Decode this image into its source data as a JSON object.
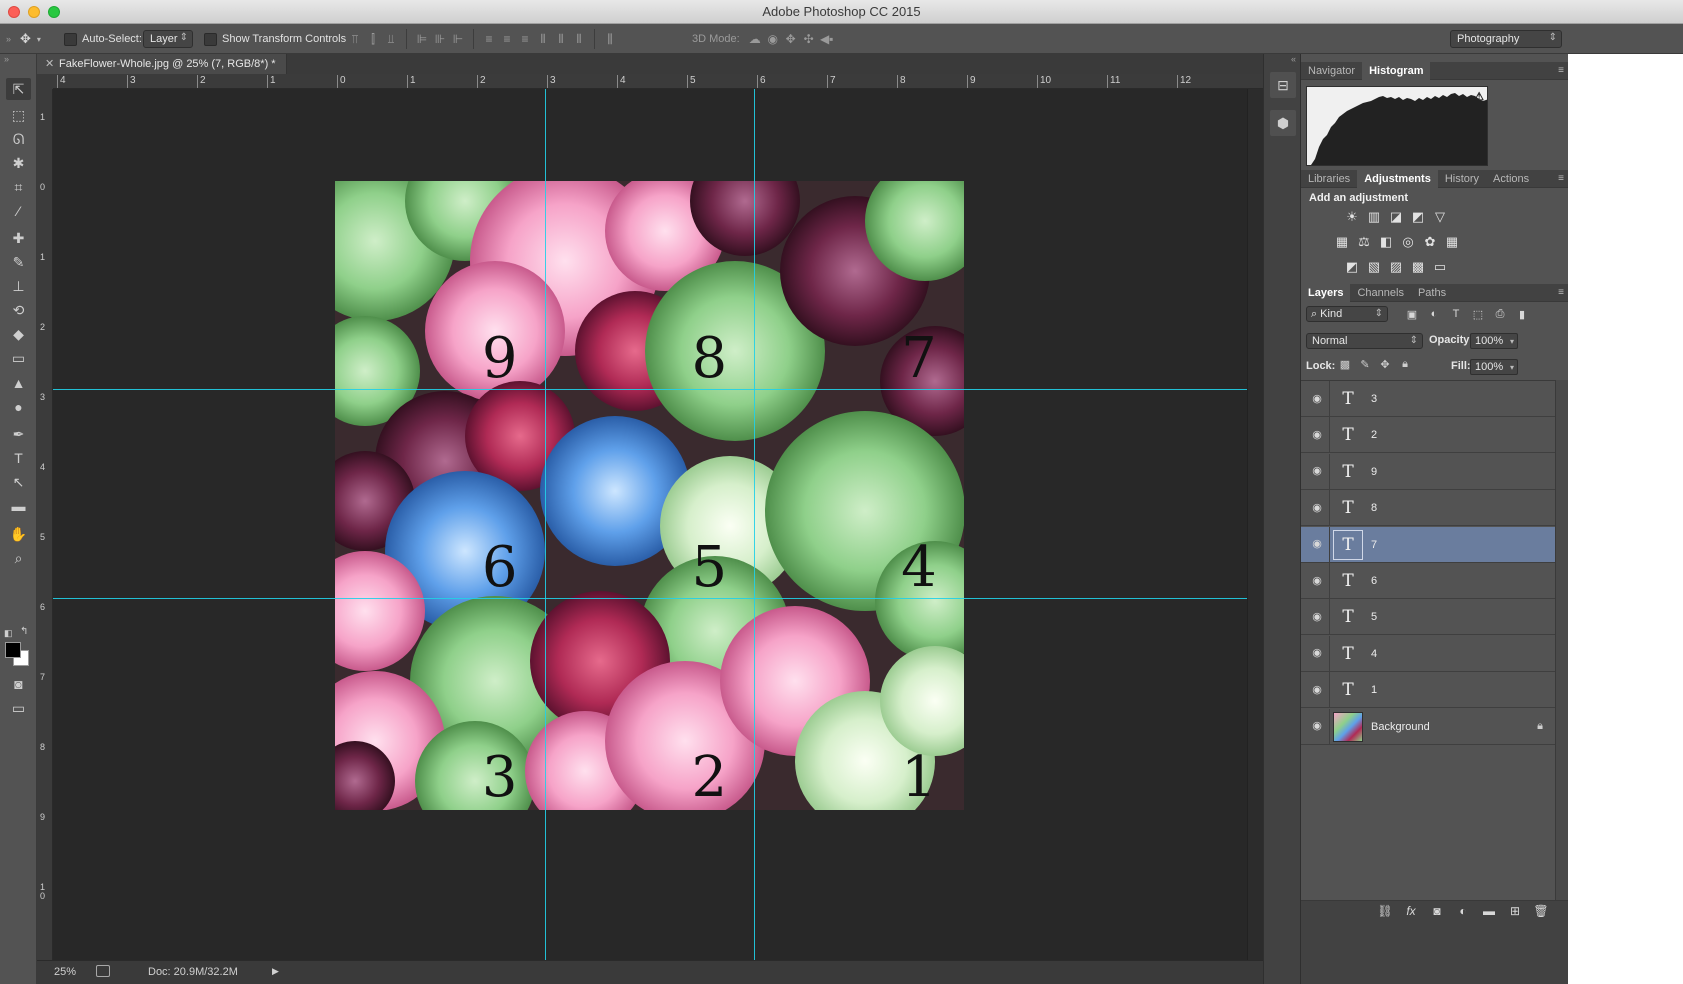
{
  "window": {
    "title": "Adobe Photoshop CC 2015"
  },
  "options_bar": {
    "auto_select_label": "Auto-Select:",
    "auto_select_value": "Layer",
    "show_transform_label": "Show Transform Controls",
    "mode_3d_label": "3D Mode:",
    "workspace": "Photography"
  },
  "document": {
    "tab_title": "FakeFlower-Whole.jpg @ 25% (7, RGB/8*) *",
    "ruler_h": [
      "4",
      "3",
      "2",
      "1",
      "0",
      "1",
      "2",
      "3",
      "4",
      "5",
      "6",
      "7",
      "8",
      "9",
      "10",
      "11",
      "12"
    ],
    "ruler_v": [
      "1",
      "0",
      "1",
      "2",
      "3",
      "4",
      "5",
      "6",
      "7",
      "8",
      "9",
      "1\n0"
    ],
    "cell_numbers": [
      "9",
      "8",
      "7",
      "6",
      "5",
      "4",
      "3",
      "2",
      "1"
    ],
    "status": {
      "zoom": "25%",
      "doc": "Doc: 20.9M/32.2M"
    }
  },
  "panels": {
    "top_tabs": [
      "Navigator",
      "Histogram"
    ],
    "top_active": "Histogram",
    "mid_tabs": [
      "Libraries",
      "Adjustments",
      "History",
      "Actions"
    ],
    "mid_active": "Adjustments",
    "adjust_title": "Add an adjustment",
    "layer_tabs": [
      "Layers",
      "Channels",
      "Paths"
    ],
    "layer_active": "Layers",
    "filter_kind": "Kind",
    "blend_mode": "Normal",
    "opacity_label": "Opacity:",
    "opacity_value": "100%",
    "lock_label": "Lock:",
    "fill_label": "Fill:",
    "fill_value": "100%"
  },
  "layers": [
    {
      "name": "3",
      "type": "text",
      "selected": false
    },
    {
      "name": "2",
      "type": "text",
      "selected": false
    },
    {
      "name": "9",
      "type": "text",
      "selected": false
    },
    {
      "name": "8",
      "type": "text",
      "selected": false
    },
    {
      "name": "7",
      "type": "text",
      "selected": true
    },
    {
      "name": "6",
      "type": "text",
      "selected": false
    },
    {
      "name": "5",
      "type": "text",
      "selected": false
    },
    {
      "name": "4",
      "type": "text",
      "selected": false
    },
    {
      "name": "1",
      "type": "text",
      "selected": false
    },
    {
      "name": "Background",
      "type": "image",
      "selected": false,
      "locked": true
    }
  ],
  "colors": {
    "guide": "#21d0e8",
    "selected_layer": "#6a7d9e",
    "foreground": "#000000",
    "background": "#ffffff"
  }
}
